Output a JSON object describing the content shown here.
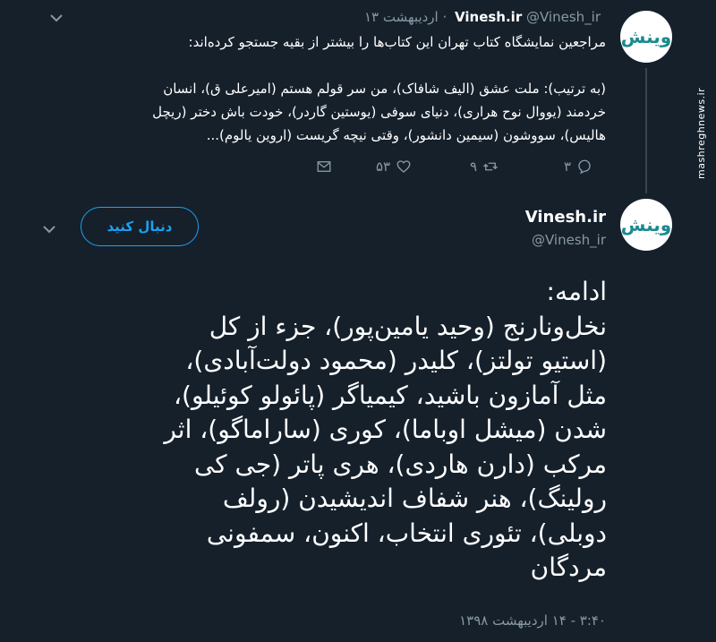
{
  "tweet1": {
    "name": "Vinesh.ir",
    "handle": "@Vinesh_ir",
    "date": "· اردیبهشت ۱۳",
    "line1": "مراجعین نمایشگاه کتاب تهران این کتاب‌ها را بیشتر از بقیه جستجو کرده‌اند:",
    "line2": "(به ترتیب): ملت عشق (الیف شافاک)، من سر قولم هستم (امیرعلی ق)، انسان",
    "line3": "خردمند (یووال نوح هراری)، دنیای سوفی (یوستین گاردر)، خودت باش دختر (ریچل",
    "line4": "هالیس)، سووشون (سیمین دانشور)، وقتی نیچه گریست (اروین یالوم)...",
    "replies": "۳",
    "retweets": "۹",
    "likes": "۵۳"
  },
  "tweet2": {
    "name": "Vinesh.ir",
    "handle": "@Vinesh_ir",
    "follow_label": "دنبال کنید",
    "body_lines": [
      "ادامه:",
      "نخل‌ونارنج (وحید یامین‌پور)، جزء از کل",
      "(استیو تولتز)، کلیدر (محمود دولت‌آبادی)،",
      "مثل آمازون باشید، کیمیاگر (پائولو کوئیلو)،",
      "شدن (میشل اوباما)، کوری (ساراماگو)، اثر",
      "مرکب (دارن هاردی)، هری پاتر (جی کی",
      "رولینگ)، هنر شفاف اندیشیدن (رولف",
      "دوبلی)، تئوری انتخاب، اکنون، سمفونی",
      "مردگان"
    ],
    "timestamp": "۳:۴۰ - ۱۴ اردیبهشت ۱۳۹۸"
  },
  "avatar_text": "وینش",
  "watermark": "mashreghnews.ir",
  "colors": {
    "bg": "#15202b",
    "accent": "#1da1f2",
    "muted": "#8899a6",
    "logo": "#1b8a8f"
  },
  "icons": [
    "chevron-down-icon",
    "reply-icon",
    "retweet-icon",
    "like-icon",
    "share-icon"
  ]
}
